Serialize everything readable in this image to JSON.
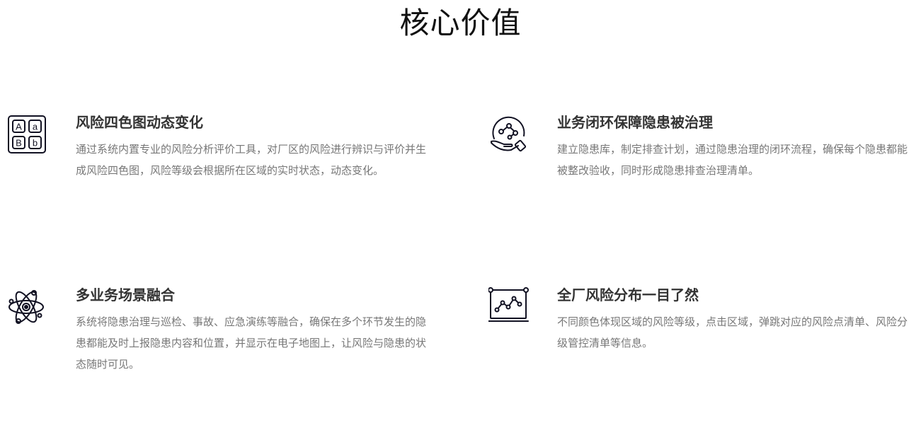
{
  "section": {
    "title": "核心价值"
  },
  "features": [
    {
      "icon": "abc-letters-icon",
      "title": "风险四色图动态变化",
      "desc": "通过系统内置专业的风险分析评价工具，对厂区的风险进行辨识与评价并生成风险四色图，风险等级会根据所在区域的实时状态，动态变化。"
    },
    {
      "icon": "hand-network-icon",
      "title": "业务闭环保障隐患被治理",
      "desc": "建立隐患库，制定排查计划，通过隐患治理的闭环流程，确保每个隐患都能被整改验收，同时形成隐患排查治理清单。"
    },
    {
      "icon": "atom-icon",
      "title": "多业务场景融合",
      "desc": "系统将隐患治理与巡检、事故、应急演练等融合，确保在多个环节发生的隐患都能及时上报隐患内容和位置，并显示在电子地图上，让风险与隐患的状态随时可见。"
    },
    {
      "icon": "chart-board-icon",
      "title": "全厂风险分布一目了然",
      "desc": "不同颜色体现区域的风险等级，点击区域，弹跳对应的风险点清单、风险分级管控清单等信息。"
    }
  ]
}
